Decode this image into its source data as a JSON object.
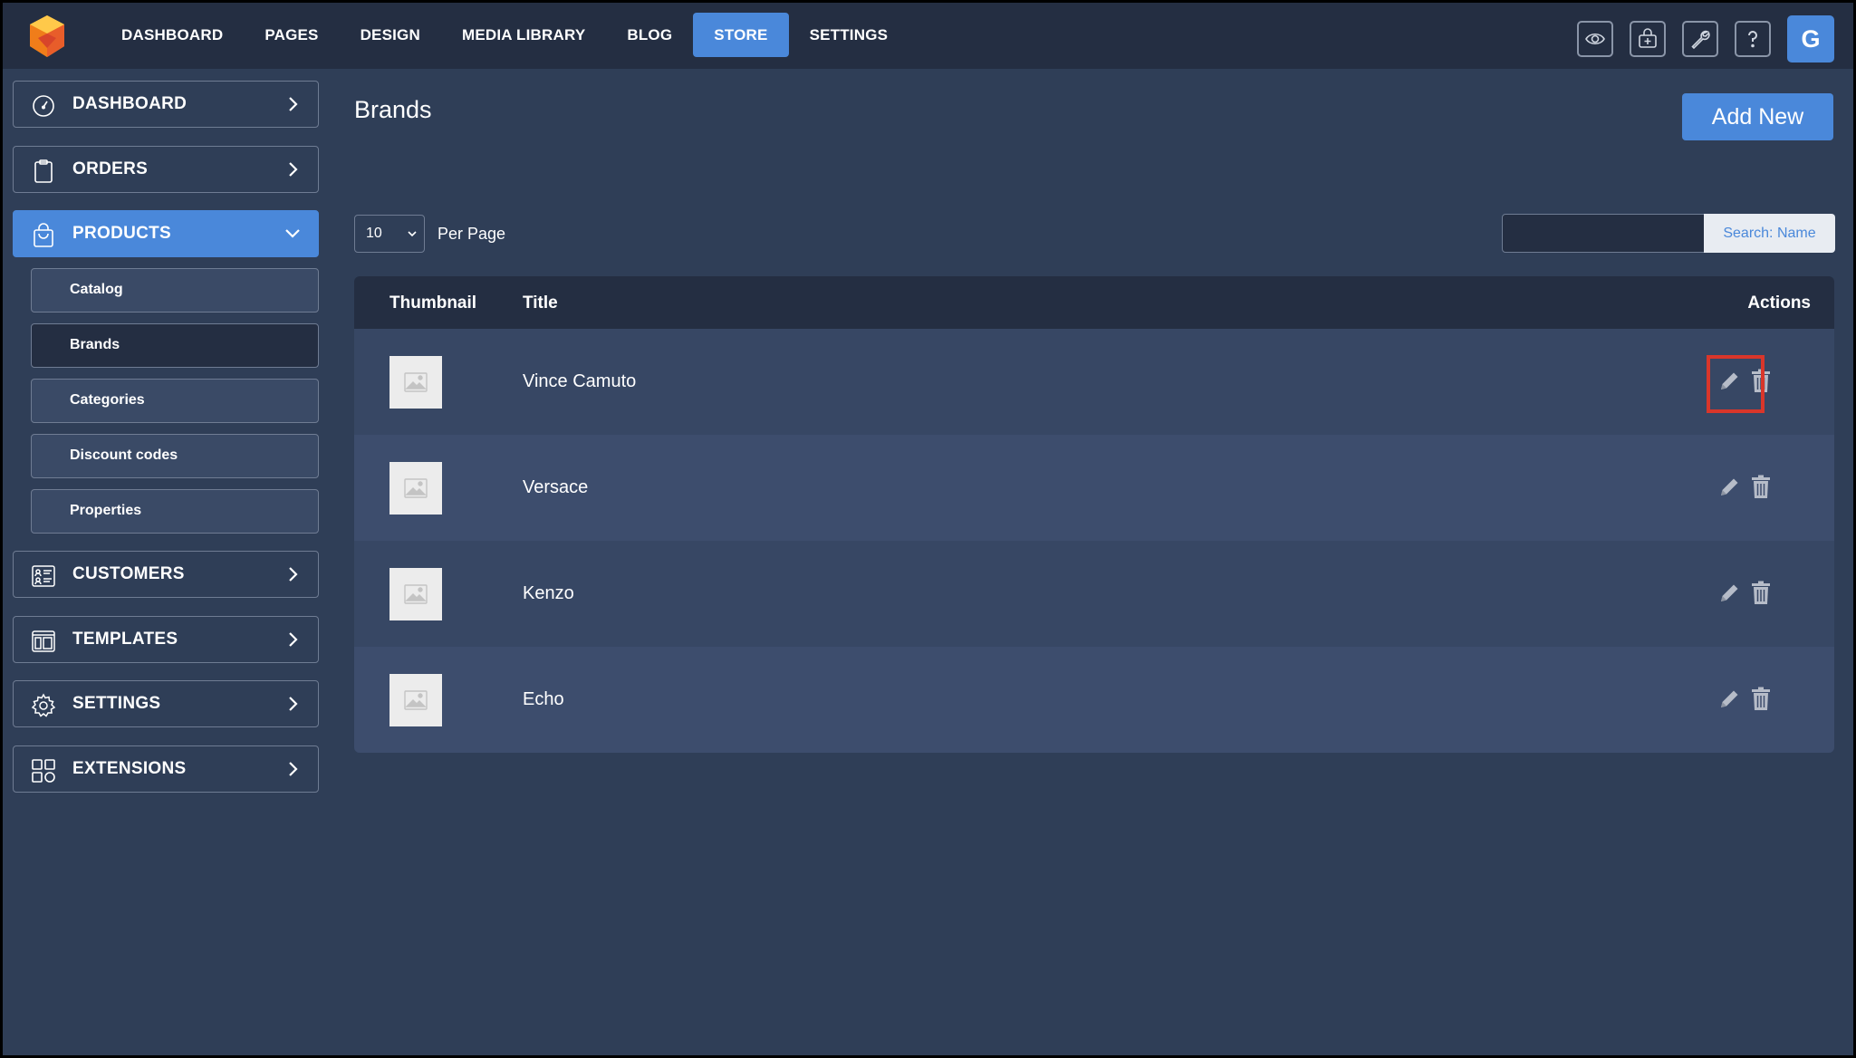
{
  "topnav": {
    "items": [
      {
        "label": "DASHBOARD",
        "active": false
      },
      {
        "label": "PAGES",
        "active": false
      },
      {
        "label": "DESIGN",
        "active": false
      },
      {
        "label": "MEDIA LIBRARY",
        "active": false
      },
      {
        "label": "BLOG",
        "active": false
      },
      {
        "label": "STORE",
        "active": true
      },
      {
        "label": "SETTINGS",
        "active": false
      }
    ],
    "icons": [
      "eye-icon",
      "add-to-basket-icon",
      "wrench-icon",
      "help-icon"
    ],
    "avatar_initial": "G"
  },
  "sidebar": {
    "items": [
      {
        "label": "DASHBOARD",
        "icon": "speedometer-icon"
      },
      {
        "label": "ORDERS",
        "icon": "clipboard-icon"
      },
      {
        "label": "PRODUCTS",
        "icon": "shopping-bag-icon",
        "active": true,
        "expanded": true
      },
      {
        "label": "CUSTOMERS",
        "icon": "contacts-card-icon"
      },
      {
        "label": "TEMPLATES",
        "icon": "layout-icon"
      },
      {
        "label": "SETTINGS",
        "icon": "gear-icon"
      },
      {
        "label": "EXTENSIONS",
        "icon": "grid-shapes-icon"
      }
    ],
    "sub_items": [
      {
        "label": "Catalog",
        "active": false
      },
      {
        "label": "Brands",
        "active": true
      },
      {
        "label": "Categories",
        "active": false
      },
      {
        "label": "Discount codes",
        "active": false
      },
      {
        "label": "Properties",
        "active": false
      }
    ]
  },
  "main": {
    "title": "Brands",
    "add_button": "Add New",
    "per_page_value": "10",
    "per_page_label": "Per Page",
    "search_value": "",
    "search_button": "Search: Name",
    "table": {
      "headers": {
        "thumbnail": "Thumbnail",
        "title": "Title",
        "actions": "Actions"
      },
      "rows": [
        {
          "title": "Vince Camuto",
          "highlighted_edit": true
        },
        {
          "title": "Versace"
        },
        {
          "title": "Kenzo"
        },
        {
          "title": "Echo"
        }
      ]
    }
  },
  "colors": {
    "topbar": "#242e42",
    "background": "#2f3e57",
    "accent": "#4a88da",
    "highlight": "#d9362a"
  }
}
